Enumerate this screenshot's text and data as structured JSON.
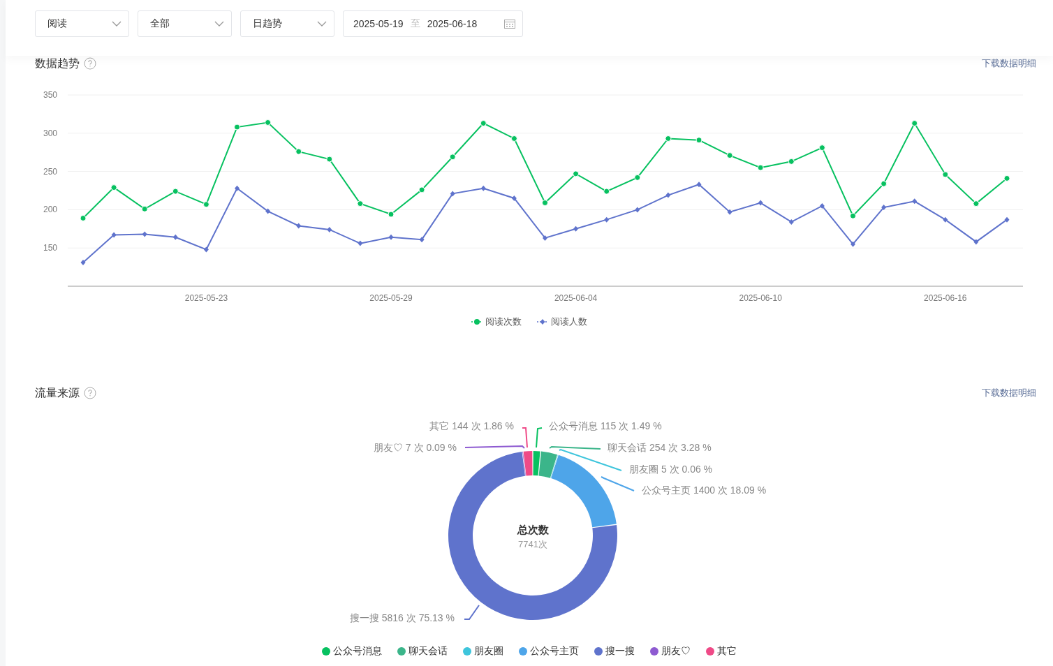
{
  "filters": [
    {
      "kind": "select",
      "value": "阅读"
    },
    {
      "kind": "select",
      "value": "全部"
    },
    {
      "kind": "select",
      "value": "日趋势"
    }
  ],
  "date_range": {
    "start": "2025-05-19",
    "separator": "至",
    "end": "2025-06-18"
  },
  "trend": {
    "title": "数据趋势",
    "download": "下载数据明细",
    "chart_data": {
      "type": "line",
      "grid": true,
      "categories": [
        null,
        null,
        null,
        null,
        "2025-05-23",
        null,
        null,
        null,
        null,
        null,
        "2025-05-29",
        null,
        null,
        null,
        null,
        null,
        "2025-06-04",
        null,
        null,
        null,
        null,
        null,
        "2025-06-10",
        null,
        null,
        null,
        null,
        null,
        "2025-06-16",
        null,
        null
      ],
      "series": [
        {
          "name": "阅读次数",
          "color": "#07c160",
          "marker": "circle",
          "values": [
            189,
            229,
            201,
            224,
            207,
            308,
            314,
            276,
            266,
            208,
            194,
            226,
            269,
            313,
            293,
            209,
            247,
            224,
            242,
            293,
            291,
            271,
            255,
            263,
            281,
            192,
            234,
            313,
            246,
            208,
            241
          ]
        },
        {
          "name": "阅读人数",
          "color": "#5f73cc",
          "marker": "diamond",
          "values": [
            131,
            167,
            168,
            164,
            148,
            228,
            198,
            179,
            174,
            156,
            164,
            161,
            221,
            228,
            215,
            163,
            175,
            187,
            200,
            219,
            233,
            197,
            209,
            184,
            205,
            155,
            203,
            211,
            187,
            158,
            187
          ]
        }
      ],
      "ylim": [
        100,
        350
      ],
      "yticks": [
        150,
        200,
        250,
        300,
        350
      ]
    }
  },
  "traffic": {
    "title": "流量来源",
    "download": "下载数据明细",
    "center_title": "总次数",
    "center_value": "7741次",
    "chart_data": {
      "type": "donut",
      "categories": [
        "公众号消息",
        "聊天会话",
        "朋友圈",
        "公众号主页",
        "搜一搜",
        "朋友♡",
        "其它"
      ],
      "values": [
        1.49,
        3.28,
        0.06,
        18.09,
        75.13,
        0.09,
        1.86
      ]
    },
    "labels": [
      {
        "text": "其它 144 次 1.86 %",
        "color": "#ef4a87"
      },
      {
        "text": "公众号消息 115 次 1.49 %",
        "color": "#07c160"
      },
      {
        "text": "朋友♡ 7 次 0.09 %",
        "color": "#8e5bd1"
      },
      {
        "text": "聊天会话 254 次 3.28 %",
        "color": "#3bb58a"
      },
      {
        "text": "朋友圈 5 次 0.06 %",
        "color": "#3ec5dc"
      },
      {
        "text": "公众号主页 1400 次 18.09 %",
        "color": "#4ea5e9"
      },
      {
        "text": "搜一搜 5816 次 75.13 %",
        "color": "#5f73cc"
      }
    ],
    "legend": [
      {
        "color": "#07c160"
      },
      {
        "color": "#3bb58a"
      },
      {
        "color": "#3ec5dc"
      },
      {
        "color": "#4ea5e9"
      },
      {
        "color": "#5f73cc"
      },
      {
        "color": "#8e5bd1"
      },
      {
        "color": "#ef4a87"
      }
    ]
  }
}
